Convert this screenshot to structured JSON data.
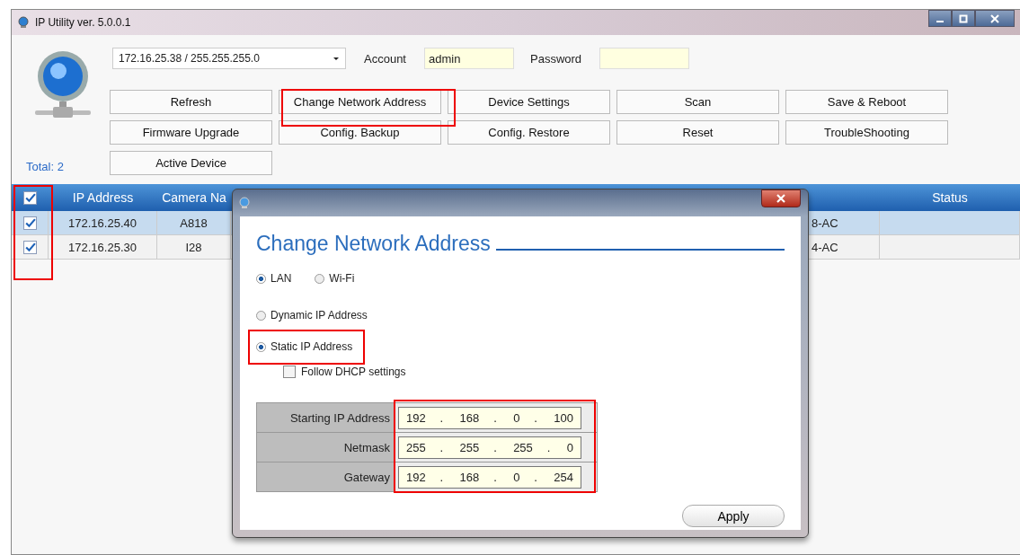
{
  "window": {
    "title": "IP Utility ver. 5.0.0.1"
  },
  "toolbar": {
    "adapter": "172.16.25.38 / 255.255.255.0",
    "account_label": "Account",
    "account": "admin",
    "password_label": "Password",
    "buttons": [
      {
        "label": "Refresh"
      },
      {
        "label": "Change Network Address"
      },
      {
        "label": "Device Settings"
      },
      {
        "label": "Scan"
      },
      {
        "label": "Save & Reboot"
      },
      {
        "label": "Firmware Upgrade"
      },
      {
        "label": "Config. Backup"
      },
      {
        "label": "Config. Restore"
      },
      {
        "label": "Reset"
      },
      {
        "label": "TroubleShooting"
      },
      {
        "label": "Active Device"
      }
    ]
  },
  "total": "Total: 2",
  "table": {
    "all_checked": true,
    "columns": [
      "IP Address",
      "Camera Na",
      "Status"
    ],
    "rows": [
      {
        "checked": true,
        "selected": true,
        "ip": "172.16.25.40",
        "camera": "A818",
        "column_4": "8-AC"
      },
      {
        "checked": true,
        "selected": false,
        "ip": "172.16.25.30",
        "camera": "I28",
        "column_4": "4-AC"
      }
    ]
  },
  "dialog": {
    "heading": "Change Network Address",
    "link_types": [
      {
        "label": "LAN",
        "selected": true
      },
      {
        "label": "Wi-Fi",
        "selected": false
      }
    ],
    "modes": [
      {
        "label": "Dynamic IP Address",
        "selected": false
      },
      {
        "label": "Static IP Address",
        "selected": true
      }
    ],
    "follow_dhcp": {
      "label": "Follow DHCP settings",
      "checked": false
    },
    "fields": [
      {
        "label": "Starting IP Address",
        "parts": [
          "192",
          ".",
          "168",
          ".",
          "0",
          ".",
          "100"
        ]
      },
      {
        "label": "Netmask",
        "parts": [
          "255",
          ".",
          "255",
          ".",
          "255",
          ".",
          "0"
        ]
      },
      {
        "label": "Gateway",
        "parts": [
          "192",
          ".",
          "168",
          ".",
          "0",
          ".",
          "254"
        ]
      }
    ],
    "apply": "Apply"
  }
}
